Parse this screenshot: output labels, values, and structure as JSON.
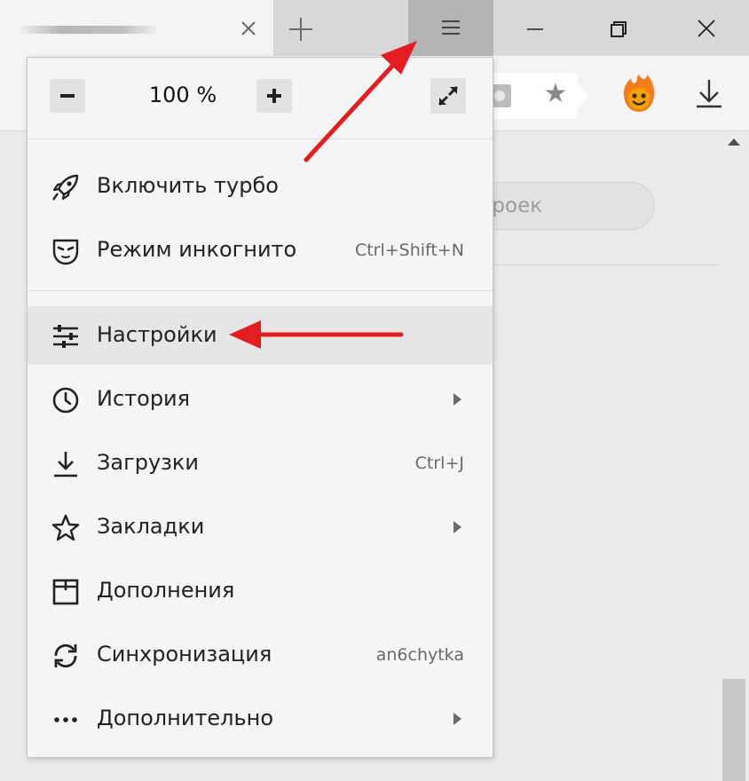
{
  "tabbar": {
    "tab_close_icon": "close-icon",
    "new_tab_icon": "plus-icon",
    "menu_icon": "hamburger-menu-icon",
    "window_controls": [
      "minimize-icon",
      "restore-icon",
      "close-icon"
    ]
  },
  "toolbar": {
    "bookmark_icon": "star-icon",
    "extension_icon": "flame-face-icon",
    "download_icon": "download-icon"
  },
  "content": {
    "search_partial_text": "троек"
  },
  "menu": {
    "zoom": {
      "value": "100 %",
      "decrease_icon": "minus-icon",
      "increase_icon": "plus-icon",
      "fullscreen_icon": "fullscreen-icon"
    },
    "items": [
      {
        "label": "Включить турбо",
        "icon": "rocket-icon",
        "hint": ""
      },
      {
        "label": "Режим инкогнито",
        "icon": "incognito-mask-icon",
        "hint": "Ctrl+Shift+N"
      },
      {
        "label": "Настройки",
        "icon": "settings-sliders-icon",
        "hint": "",
        "highlighted": true
      },
      {
        "label": "История",
        "icon": "clock-icon",
        "hint": "",
        "submenu": true
      },
      {
        "label": "Загрузки",
        "icon": "download-icon",
        "hint": "Ctrl+J"
      },
      {
        "label": "Закладки",
        "icon": "star-icon",
        "hint": "",
        "submenu": true
      },
      {
        "label": "Дополнения",
        "icon": "addons-icon",
        "hint": ""
      },
      {
        "label": "Синхронизация",
        "icon": "sync-icon",
        "hint": "an6chytka"
      },
      {
        "label": "Дополнительно",
        "icon": "more-dots-icon",
        "hint": "",
        "submenu": true
      }
    ]
  },
  "colors": {
    "annotation_arrow": "#e41e20",
    "highlight_row": "#e6e6e6",
    "menu_button_active": "#b4b4b4"
  }
}
